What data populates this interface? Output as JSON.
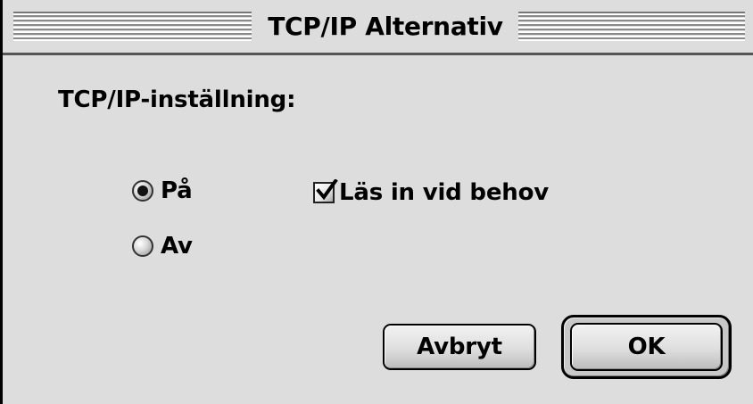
{
  "window": {
    "title": "TCP/IP Alternativ"
  },
  "settings": {
    "section_label": "TCP/IP-inställning:",
    "radio_on_label": "På",
    "radio_off_label": "Av",
    "selected": "På",
    "load_on_demand_label": "Läs in vid behov",
    "load_on_demand_checked": true
  },
  "buttons": {
    "cancel_label": "Avbryt",
    "ok_label": "OK"
  },
  "icons": {
    "checkbox": "checkmark-icon",
    "radio": "radio-dot-icon"
  }
}
